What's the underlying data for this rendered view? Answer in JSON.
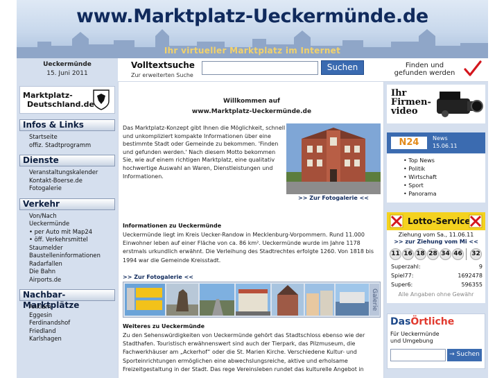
{
  "header": {
    "title": "www.Marktplatz-Ueckermünde.de",
    "slogan": "Ihr virtueller Marktplatz im Internet"
  },
  "topbar": {
    "town": "Ueckermünde",
    "date": "15. Juni 2011",
    "search_title": "Volltextsuche",
    "search_sub": "Zur erweiterten Suche",
    "search_value": "",
    "search_button": "Suchen",
    "found_line1": "Finden und",
    "found_line2": "gefunden werden"
  },
  "left": {
    "logo_line1": "Marktplatz-",
    "logo_line2": "Deutschland.de",
    "sections": [
      {
        "title": "Infos & Links",
        "items": [
          "Startseite",
          "offiz. Stadtprogramm"
        ]
      },
      {
        "title": "Dienste",
        "items": [
          "Veranstaltungskalender",
          "Kontakt-Boerse.de",
          "Fotogalerie"
        ]
      },
      {
        "title": "Verkehr",
        "items": [
          "Von/Nach",
          "Ueckermünde",
          "• per Auto mit Map24",
          "• öff. Verkehrsmittel",
          "Staumelder",
          "Baustelleninformationen",
          "Radarfallen",
          "Die Bahn",
          "Airports.de"
        ]
      },
      {
        "title": "Nachbar-Marktplätze",
        "items": [
          "Anklam",
          "Eggesin",
          "Ferdinandshof",
          "Friedland",
          "Karlshagen"
        ]
      }
    ]
  },
  "main": {
    "welcome_line1": "Willkommen auf",
    "welcome_line2": "www.Marktplatz-Ueckermünde.de",
    "intro": "Das Marktplatz-Konzept gibt Ihnen die Möglichkeit, schnell und unkompliziert kompakte Informationen über eine bestimmte Stadt oder Gemeinde zu bekommen. 'Finden und gefunden werden.' Nach diesem Motto bekommen Sie, wie auf einem richtigen Marktplatz, eine qualitativ hochwertige Auswahl an Waren, Dienstleistungen und Informationen.",
    "photo_link": ">> Zur Fotogalerie <<",
    "info_heading": "Informationen zu Ueckermünde",
    "info_text": "Ueckermünde liegt im Kreis Uecker-Randow in Mecklenburg-Vorpommern. Rund 11.000 Einwohner leben auf einer Fläche von ca. 86 km². Ueckermünde wurde im Jahre 1178 erstmals urkundlich erwähnt. Die Verleihung des Stadtrechtes erfolgte 1260. Von 1818 bis 1994 war die Gemeinde Kreisstadt.",
    "gallery_link": ">> Zur Fotogalerie <<",
    "gallery_label": "Galerie",
    "more_heading": "Weiteres zu Ueckermünde",
    "more_text": "Zu den Sehenswürdigkeiten von Ueckermünde gehört das Stadtschloss ebenso wie der Stadthafen. Touristisch erwähnenswert sind auch der Tierpark, das Pilzmuseum, die Fachwerkhäuser am „Ackerhof“ oder die St. Marien Kirche. Verschiedene Kultur- und Sporteinrichtungen ermöglichen eine abwechslungsreiche, aktive und erholsame Freizeitgestaltung in der Stadt. Das rege Vereinsleben rundet das kulturelle Angebot in"
  },
  "right": {
    "video_line1": "Ihr",
    "video_line2": "Firmen-",
    "video_line3": "video",
    "n24_logo": "N24",
    "n24_news": "News",
    "n24_date": "15.06.11",
    "n24_items": [
      "• Top News",
      "• Politik",
      "• Wirtschaft",
      "• Sport",
      "• Panorama"
    ],
    "lotto_title": "Lotto-Service",
    "lotto_draw": "Ziehung vom Sa., 11.06.11",
    "lotto_next": ">> zur Ziehung vom Mi <<",
    "lotto_numbers": [
      "11",
      "16",
      "18",
      "28",
      "34",
      "46",
      "32"
    ],
    "superzahl_label": "Superzahl:",
    "superzahl_value": "9",
    "spiel77_label": "Spiel77:",
    "spiel77_value": "1692478",
    "super6_label": "Super6:",
    "super6_value": "596355",
    "lotto_note": "Alle Angaben ohne Gewähr",
    "oertliche_logo_a": "Das",
    "oertliche_logo_b": "Örtliche",
    "oertliche_sub1": "Für Ueckermünde",
    "oertliche_sub2": "und Umgebung",
    "oertliche_button": "→ Suchen"
  },
  "colors": {
    "sidebar_bg": "#d5dfee",
    "title": "#102a5c",
    "search_button": "#3a6ab0",
    "lotto": "#f4d21f",
    "n24": "#3b6bb0"
  }
}
